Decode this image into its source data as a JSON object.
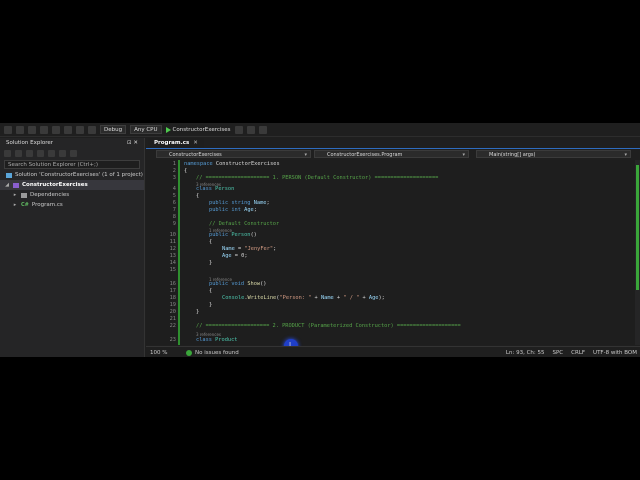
{
  "toolbar": {
    "config": "Debug",
    "platform": "Any CPU",
    "run_target": "ConstructorExercises"
  },
  "solution_explorer": {
    "title": "Solution Explorer",
    "pin": "⊡ ✕",
    "search_placeholder": "Search Solution Explorer (Ctrl+;)",
    "solution": "Solution 'ConstructorExercises' (1 of 1 project)",
    "project": "ConstructorExercises",
    "dependencies": "Dependencies",
    "file": "Program.cs"
  },
  "editor": {
    "tab": "Program.cs",
    "nav_project": "ConstructorExercises",
    "nav_class": "ConstructorExercises.Program",
    "nav_member": "Main(string[] args)",
    "zoom": "100 %",
    "issues": "No issues found",
    "position": "Ln: 93, Ch: 55",
    "spc": "SPC",
    "eol": "CRLF",
    "encoding": "UTF-8 with BOM",
    "lines": [
      {
        "n": "1",
        "t": "namespace ConstructorExercises"
      },
      {
        "n": "2",
        "t": "{"
      },
      {
        "n": "3",
        "t": "// ==================== 1. PERSON (Default Constructor) ===================="
      },
      {
        "ref": "3 references"
      },
      {
        "n": "4",
        "t": "class Person"
      },
      {
        "n": "5",
        "t": "{"
      },
      {
        "n": "6",
        "t": "public string Name;"
      },
      {
        "n": "7",
        "t": "public int Age;"
      },
      {
        "n": "8",
        "t": ""
      },
      {
        "n": "9",
        "t": "// Default Constructor"
      },
      {
        "ref": "1 reference"
      },
      {
        "n": "10",
        "t": "public Person()"
      },
      {
        "n": "11",
        "t": "{"
      },
      {
        "n": "12",
        "t": "Name = \"JenyFer\";"
      },
      {
        "n": "13",
        "t": "Age = 0;"
      },
      {
        "n": "14",
        "t": "}"
      },
      {
        "n": "15",
        "t": ""
      },
      {
        "ref": "1 reference"
      },
      {
        "n": "16",
        "t": "public void Show()"
      },
      {
        "n": "17",
        "t": "{"
      },
      {
        "n": "18",
        "t": "Console.WriteLine(\"Person: \" + Name + \" / \" + Age);"
      },
      {
        "n": "19",
        "t": "}"
      },
      {
        "n": "20",
        "t": "}"
      },
      {
        "n": "21",
        "t": ""
      },
      {
        "n": "22",
        "t": "// ==================== 2. PRODUCT (Parameterized Constructor) ===================="
      },
      {
        "ref": "3 references"
      },
      {
        "n": "23",
        "t": "class Product"
      }
    ]
  },
  "colors": {
    "keyword": "#569cd6",
    "type": "#4ec9b0",
    "comment": "#57a64a",
    "string": "#d69d85",
    "method": "#dcdcaa"
  }
}
